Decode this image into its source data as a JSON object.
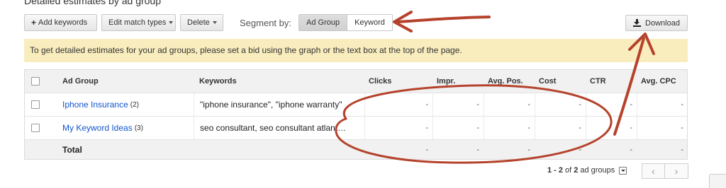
{
  "page": {
    "title": "Detailed estimates by ad group"
  },
  "toolbar": {
    "add_keywords": "Add keywords",
    "edit_match_types": "Edit match types",
    "delete": "Delete",
    "segment_label": "Segment by:",
    "segment_options": [
      "Ad Group",
      "Keyword"
    ],
    "segment_selected": "Ad Group",
    "download": "Download"
  },
  "notice": {
    "text": "To get detailed estimates for your ad groups, please set a bid using the graph or the text box at the top of the page."
  },
  "table": {
    "columns": [
      "Ad Group",
      "Keywords",
      "Clicks",
      "Impr.",
      "Avg. Pos.",
      "Cost",
      "CTR",
      "Avg. CPC"
    ],
    "rows": [
      {
        "ad_group": "Iphone Insurance",
        "count": "(2)",
        "keywords": "\"iphone insurance\", \"iphone warranty\"",
        "clicks": "-",
        "impr": "-",
        "avg_pos": "-",
        "cost": "-",
        "ctr": "-",
        "avg_cpc": "-"
      },
      {
        "ad_group": "My Keyword Ideas",
        "count": "(3)",
        "keywords": "seo consultant, seo consultant atlant…",
        "clicks": "-",
        "impr": "-",
        "avg_pos": "-",
        "cost": "-",
        "ctr": "-",
        "avg_cpc": "-"
      }
    ],
    "total": {
      "label": "Total",
      "clicks": "-",
      "impr": "-",
      "avg_pos": "-",
      "cost": "-",
      "ctr": "-",
      "avg_cpc": "-"
    }
  },
  "pagination": {
    "range": "1 - 2",
    "of_label": "of",
    "total": "2",
    "unit": "ad groups",
    "prev_icon": "chevron-left-icon",
    "next_icon": "chevron-right-icon"
  },
  "annotations": {
    "color": "#b5432c"
  }
}
